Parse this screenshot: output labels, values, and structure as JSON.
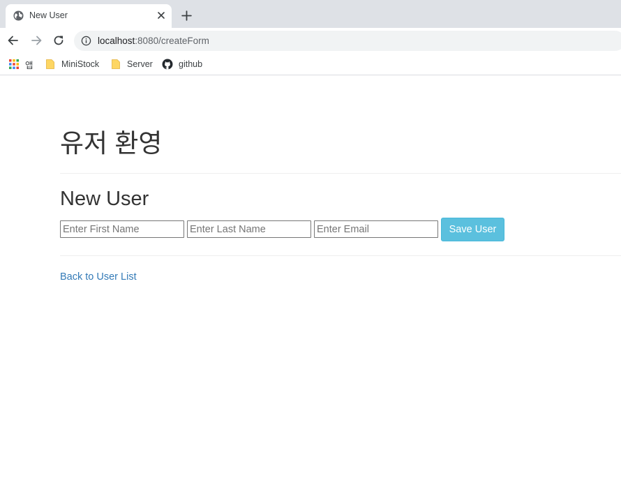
{
  "browser": {
    "tab": {
      "title": "New User"
    },
    "address_bar": {
      "host": "localhost",
      "path": ":8080/createForm"
    },
    "bookmarks": [
      {
        "label": "앱",
        "icon": "apps-grid-icon"
      },
      {
        "label": "MiniStock",
        "icon": "folder-icon"
      },
      {
        "label": "Server",
        "icon": "folder-icon"
      },
      {
        "label": "github",
        "icon": "github-icon"
      }
    ]
  },
  "page": {
    "heading": "유저 환영",
    "form": {
      "title": "New User",
      "first_name_placeholder": "Enter First Name",
      "last_name_placeholder": "Enter Last Name",
      "email_placeholder": "Enter Email",
      "save_label": "Save User"
    },
    "back_link": "Back to User List"
  },
  "colors": {
    "accent_button": "#5bc0de",
    "link": "#337ab7",
    "text": "#333333"
  }
}
